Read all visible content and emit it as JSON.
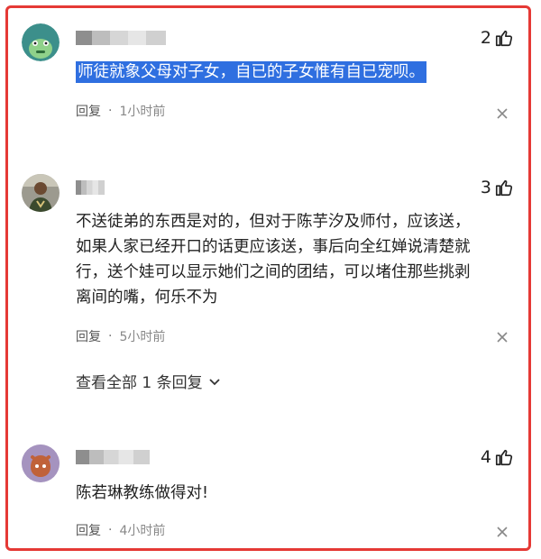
{
  "comments": [
    {
      "likes": "2",
      "text": "师徒就象父母对子女，自已的子女惟有自已宠呗。",
      "reply_label": "回复",
      "separator": "·",
      "time": "1小时前"
    },
    {
      "likes": "3",
      "text_lines": [
        "不送徒弟的东西是对的，但对于陈芋汐及师付，应该送，",
        "如果人家已经开口的话更应该送，事后向全红婵说清楚就",
        "行，送个娃可以显示她们之间的团结，可以堵住那些挑剥",
        "离间的嘴，何乐不为"
      ],
      "reply_label": "回复",
      "separator": "·",
      "time": "5小时前"
    },
    {
      "likes": "4",
      "text": "陈若琳教练做得对!",
      "reply_label": "回复",
      "separator": "·",
      "time": "4小时前"
    }
  ],
  "view_all_replies": "查看全部 1 条回复",
  "colors": {
    "border": "#e53935",
    "highlight": "#2f6fe0"
  },
  "icons": [
    "thumbs-up-icon",
    "close-icon",
    "chevron-down-icon"
  ]
}
